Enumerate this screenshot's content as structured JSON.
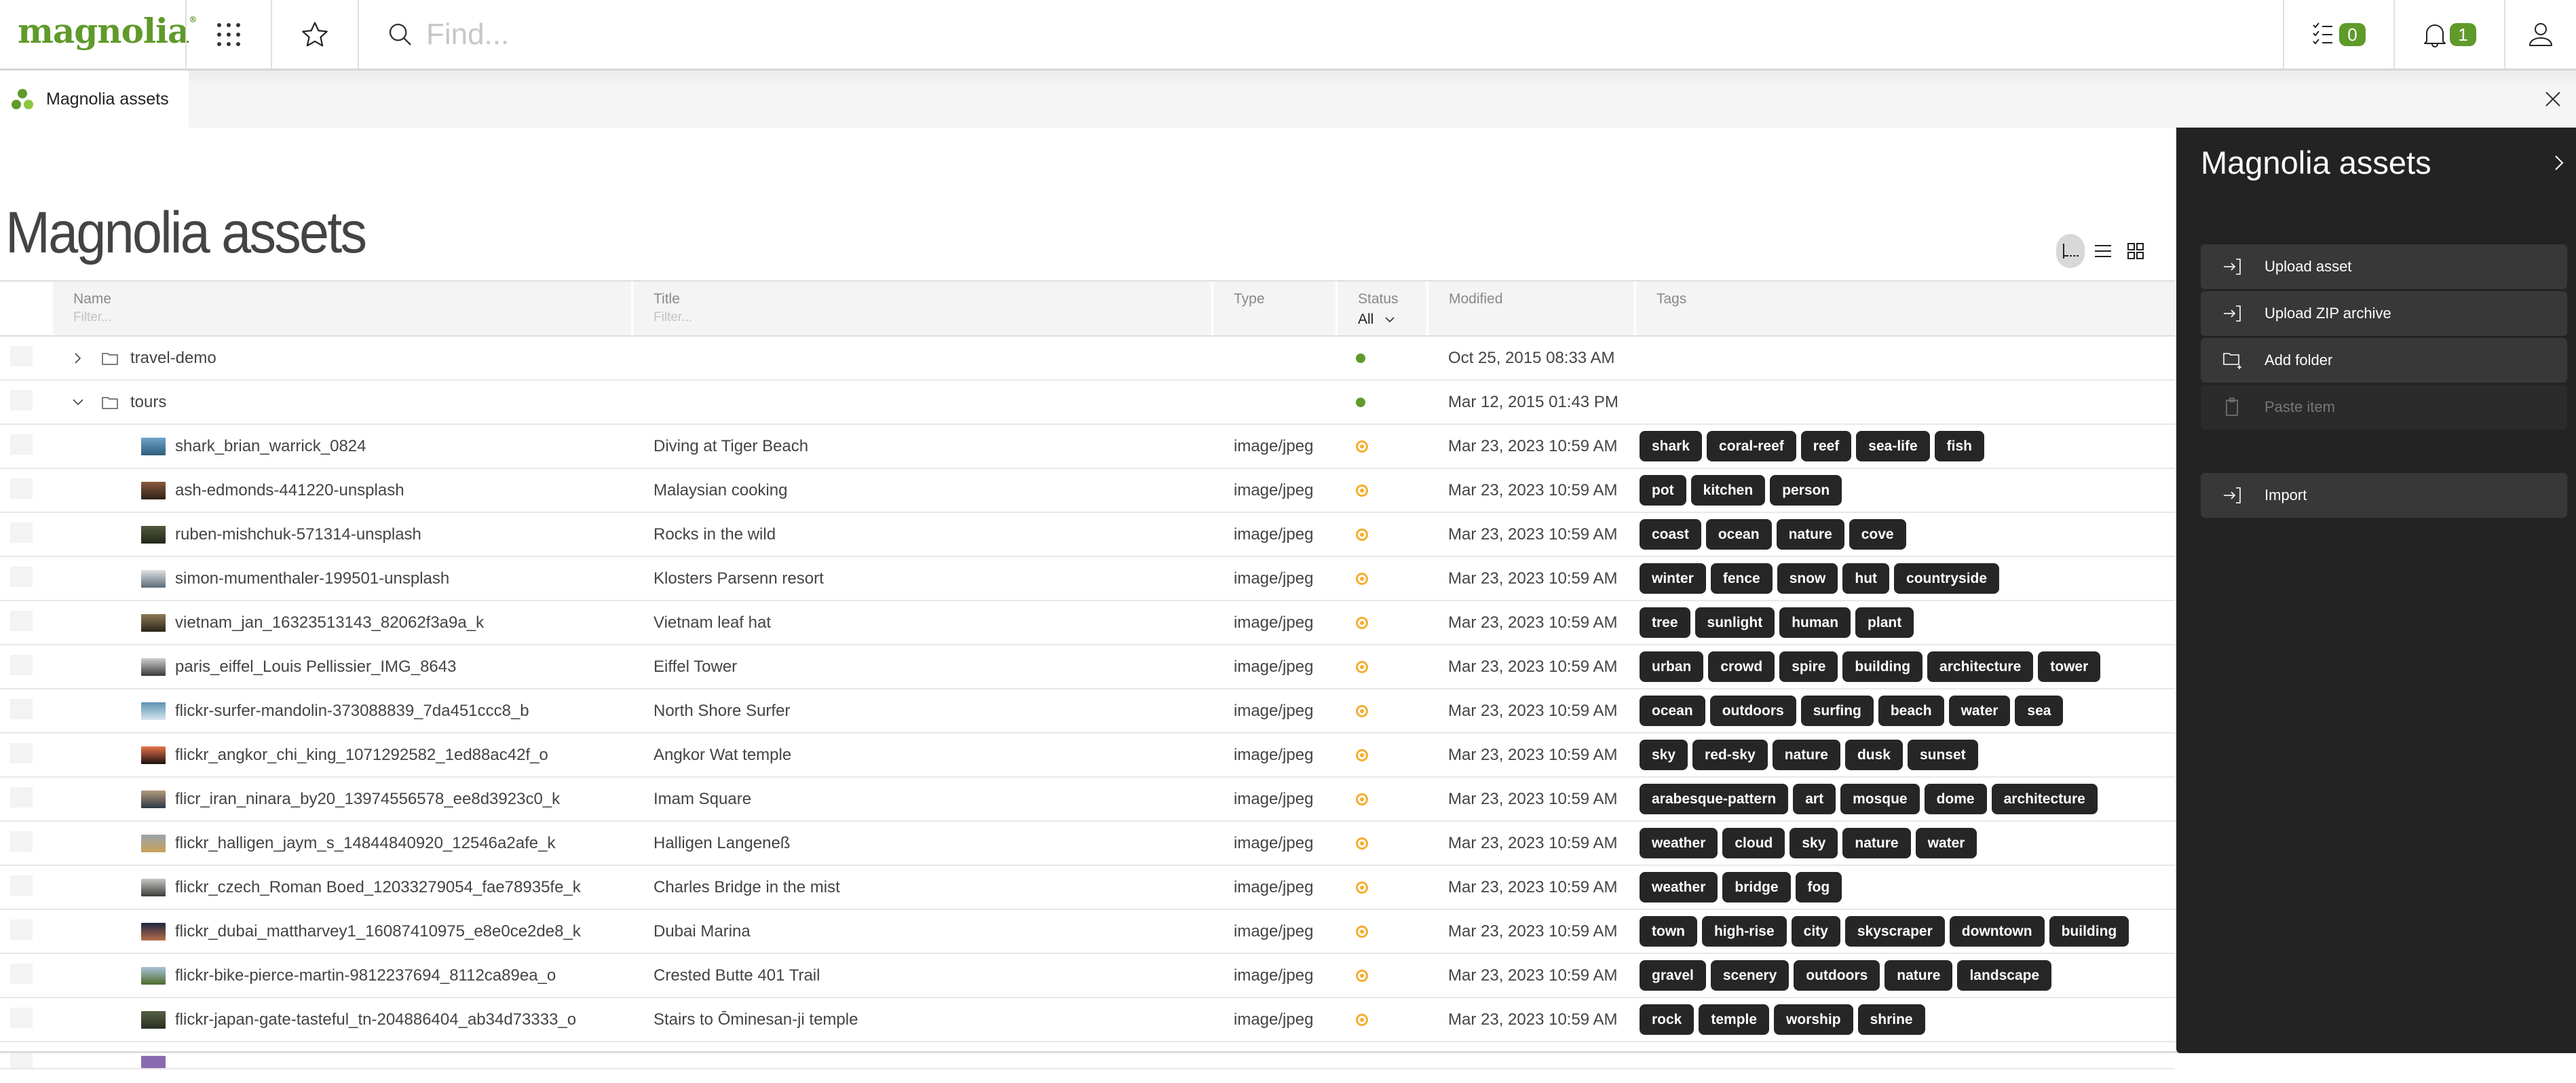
{
  "header": {
    "logo": "magnolia",
    "logo_mark": "®",
    "apps_icon": "apps-grid-icon",
    "favorites_icon": "star-icon",
    "search_placeholder": "Find...",
    "tasks_count": "0",
    "notifications_count": "1",
    "user_icon": "user-icon",
    "accent_color": "#5f9a2a"
  },
  "tabs": [
    {
      "label": "Magnolia assets",
      "icon": "magnolia-app-icon",
      "active": true
    }
  ],
  "main": {
    "title": "Magnolia assets",
    "view_modes": [
      "tree-view",
      "list-view",
      "grid-view"
    ],
    "active_view": "tree-view"
  },
  "table": {
    "columns": [
      {
        "key": "name",
        "label": "Name",
        "filter_placeholder": "Filter..."
      },
      {
        "key": "title",
        "label": "Title",
        "filter_placeholder": "Filter..."
      },
      {
        "key": "type",
        "label": "Type"
      },
      {
        "key": "status",
        "label": "Status",
        "filter_value": "All"
      },
      {
        "key": "modified",
        "label": "Modified"
      },
      {
        "key": "tags",
        "label": "Tags"
      }
    ],
    "rows": [
      {
        "kind": "folder",
        "expanded": false,
        "name": "travel-demo",
        "title": "",
        "type": "",
        "status": "published",
        "modified": "Oct 25, 2015 08:33 AM",
        "tags": []
      },
      {
        "kind": "folder",
        "expanded": true,
        "name": "tours",
        "title": "",
        "type": "",
        "status": "published",
        "modified": "Mar 12, 2015 01:43 PM",
        "tags": []
      },
      {
        "kind": "asset",
        "thumb": [
          "#6fa3c9",
          "#2f5d7a"
        ],
        "name": "shark_brian_warrick_0824",
        "title": "Diving at Tiger Beach",
        "type": "image/jpeg",
        "status": "modified",
        "modified": "Mar 23, 2023 10:59 AM",
        "tags": [
          "shark",
          "coral-reef",
          "reef",
          "sea-life",
          "fish"
        ]
      },
      {
        "kind": "asset",
        "thumb": [
          "#8a5a3c",
          "#2c211a"
        ],
        "name": "ash-edmonds-441220-unsplash",
        "title": "Malaysian cooking",
        "type": "image/jpeg",
        "status": "modified",
        "modified": "Mar 23, 2023 10:59 AM",
        "tags": [
          "pot",
          "kitchen",
          "person"
        ]
      },
      {
        "kind": "asset",
        "thumb": [
          "#4f5a3a",
          "#22261a"
        ],
        "name": "ruben-mishchuk-571314-unsplash",
        "title": "Rocks in the wild",
        "type": "image/jpeg",
        "status": "modified",
        "modified": "Mar 23, 2023 10:59 AM",
        "tags": [
          "coast",
          "ocean",
          "nature",
          "cove"
        ]
      },
      {
        "kind": "asset",
        "thumb": [
          "#dfe2e4",
          "#5d6a78"
        ],
        "name": "simon-mumenthaler-199501-unsplash",
        "title": "Klosters Parsenn resort",
        "type": "image/jpeg",
        "status": "modified",
        "modified": "Mar 23, 2023 10:59 AM",
        "tags": [
          "winter",
          "fence",
          "snow",
          "hut",
          "countryside"
        ]
      },
      {
        "kind": "asset",
        "thumb": [
          "#8b7a55",
          "#2a241a"
        ],
        "name": "vietnam_jan_16323513143_82062f3a9a_k",
        "title": "Vietnam leaf hat",
        "type": "image/jpeg",
        "status": "modified",
        "modified": "Mar 23, 2023 10:59 AM",
        "tags": [
          "tree",
          "sunlight",
          "human",
          "plant"
        ]
      },
      {
        "kind": "asset",
        "thumb": [
          "#cfcfcf",
          "#3a3a3a"
        ],
        "name": "paris_eiffel_Louis Pellissier_IMG_8643",
        "title": "Eiffel Tower",
        "type": "image/jpeg",
        "status": "modified",
        "modified": "Mar 23, 2023 10:59 AM",
        "tags": [
          "urban",
          "crowd",
          "spire",
          "building",
          "architecture",
          "tower"
        ]
      },
      {
        "kind": "asset",
        "thumb": [
          "#5b93b3",
          "#d7e5ee"
        ],
        "name": "flickr-surfer-mandolin-373088839_7da451ccc8_b",
        "title": "North Shore Surfer",
        "type": "image/jpeg",
        "status": "modified",
        "modified": "Mar 23, 2023 10:59 AM",
        "tags": [
          "ocean",
          "outdoors",
          "surfing",
          "beach",
          "water",
          "sea"
        ]
      },
      {
        "kind": "asset",
        "thumb": [
          "#e8734a",
          "#1a1010"
        ],
        "name": "flickr_angkor_chi_king_1071292582_1ed88ac42f_o",
        "title": "Angkor Wat temple",
        "type": "image/jpeg",
        "status": "modified",
        "modified": "Mar 23, 2023 10:59 AM",
        "tags": [
          "sky",
          "red-sky",
          "nature",
          "dusk",
          "sunset"
        ]
      },
      {
        "kind": "asset",
        "thumb": [
          "#b39a7a",
          "#2d3848"
        ],
        "name": "flicr_iran_ninara_by20_13974556578_ee8d3923c0_k",
        "title": "Imam Square",
        "type": "image/jpeg",
        "status": "modified",
        "modified": "Mar 23, 2023 10:59 AM",
        "tags": [
          "arabesque-pattern",
          "art",
          "mosque",
          "dome",
          "architecture"
        ]
      },
      {
        "kind": "asset",
        "thumb": [
          "#9aa3ab",
          "#c9a25a"
        ],
        "name": "flickr_halligen_jaym_s_14844840920_12546a2afe_k",
        "title": "Halligen Langeneß",
        "type": "image/jpeg",
        "status": "modified",
        "modified": "Mar 23, 2023 10:59 AM",
        "tags": [
          "weather",
          "cloud",
          "sky",
          "nature",
          "water"
        ]
      },
      {
        "kind": "asset",
        "thumb": [
          "#c8c8c4",
          "#3b3b38"
        ],
        "name": "flickr_czech_Roman Boed_12033279054_fae78935fe_k",
        "title": "Charles Bridge in the mist",
        "type": "image/jpeg",
        "status": "modified",
        "modified": "Mar 23, 2023 10:59 AM",
        "tags": [
          "weather",
          "bridge",
          "fog"
        ]
      },
      {
        "kind": "asset",
        "thumb": [
          "#1d2540",
          "#b86d4a"
        ],
        "name": "flickr_dubai_mattharvey1_16087410975_e8e0ce2de8_k",
        "title": "Dubai Marina",
        "type": "image/jpeg",
        "status": "modified",
        "modified": "Mar 23, 2023 10:59 AM",
        "tags": [
          "town",
          "high-rise",
          "city",
          "skyscraper",
          "downtown",
          "building"
        ]
      },
      {
        "kind": "asset",
        "thumb": [
          "#a9c3dc",
          "#4d6b2a"
        ],
        "name": "flickr-bike-pierce-martin-9812237694_8112ca89ea_o",
        "title": "Crested Butte 401 Trail",
        "type": "image/jpeg",
        "status": "modified",
        "modified": "Mar 23, 2023 10:59 AM",
        "tags": [
          "gravel",
          "scenery",
          "outdoors",
          "nature",
          "landscape"
        ]
      },
      {
        "kind": "asset",
        "thumb": [
          "#556045",
          "#2a2f22"
        ],
        "name": "flickr-japan-gate-tasteful_tn-204886404_ab34d73333_o",
        "title": "Stairs to Ōminesan-ji temple",
        "type": "image/jpeg",
        "status": "modified",
        "modified": "Mar 23, 2023 10:59 AM",
        "tags": [
          "rock",
          "temple",
          "worship",
          "shrine"
        ]
      }
    ]
  },
  "status_colors": {
    "published": "#5f9a2a",
    "modified": "#f5ad2f"
  },
  "action_panel": {
    "title": "Magnolia assets",
    "actions": [
      {
        "label": "Upload asset",
        "icon": "upload-icon",
        "enabled": true
      },
      {
        "label": "Upload ZIP archive",
        "icon": "upload-icon",
        "enabled": true
      },
      {
        "label": "Add folder",
        "icon": "add-folder-icon",
        "enabled": true
      },
      {
        "label": "Paste item",
        "icon": "clipboard-icon",
        "enabled": false
      },
      {
        "label": "Import",
        "icon": "import-icon",
        "enabled": true
      }
    ]
  }
}
